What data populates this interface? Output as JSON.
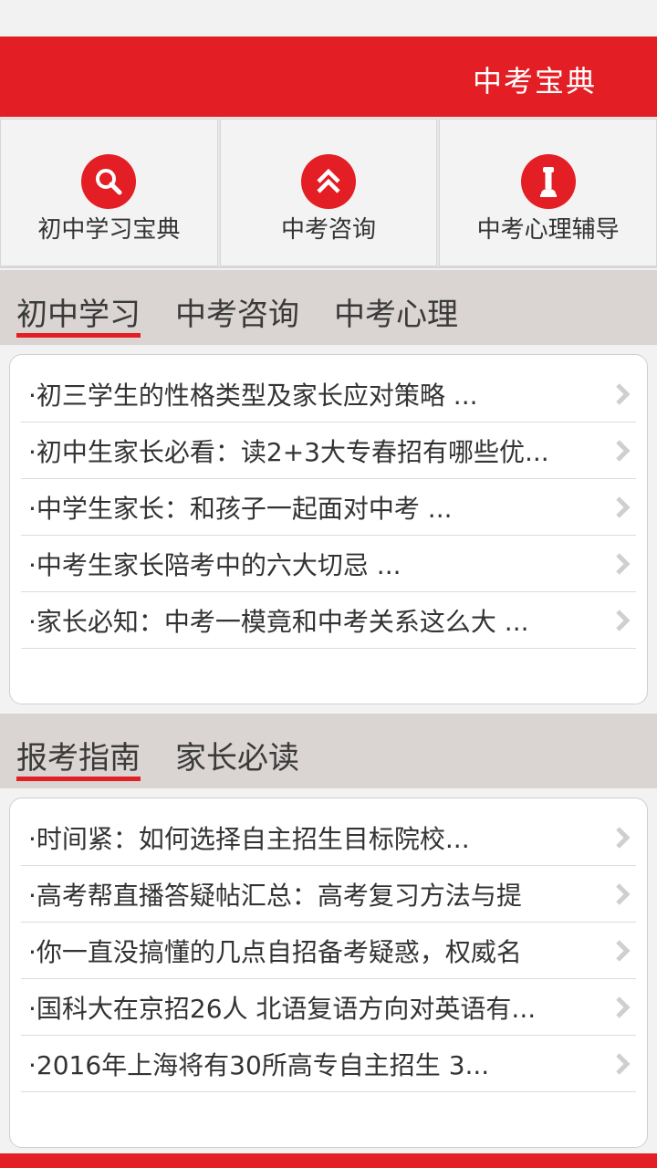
{
  "header": {
    "title": "中考宝典"
  },
  "shortcuts": [
    {
      "label": "初中学习宝典",
      "icon": "search-icon"
    },
    {
      "label": "中考咨询",
      "icon": "double-chevron-up-icon"
    },
    {
      "label": "中考心理辅导",
      "icon": "chess-piece-icon"
    }
  ],
  "section1": {
    "tabs": [
      "初中学习",
      "中考咨询",
      "中考心理"
    ],
    "active_tab": 0,
    "items": [
      "·初三学生的性格类型及家长应对策略 ...",
      "·初中生家长必看：读2+3大专春招有哪些优...",
      "·中学生家长：和孩子一起面对中考 ...",
      "·中考生家长陪考中的六大切忌 ...",
      "·家长必知：中考一模竟和中考关系这么大 ..."
    ]
  },
  "section2": {
    "tabs": [
      "报考指南",
      "家长必读"
    ],
    "active_tab": 0,
    "items": [
      "·时间紧：如何选择自主招生目标院校...",
      "·高考帮直播答疑帖汇总：高考复习方法与提",
      "·你一直没搞懂的几点自招备考疑惑，权威名",
      "·国科大在京招26人 北语复语方向对英语有...",
      "·2016年上海将有30所高专自主招生 3..."
    ]
  },
  "colors": {
    "accent": "#e31e24",
    "tab_bg": "#dad4d2",
    "page_bg": "#f2f2f2"
  }
}
